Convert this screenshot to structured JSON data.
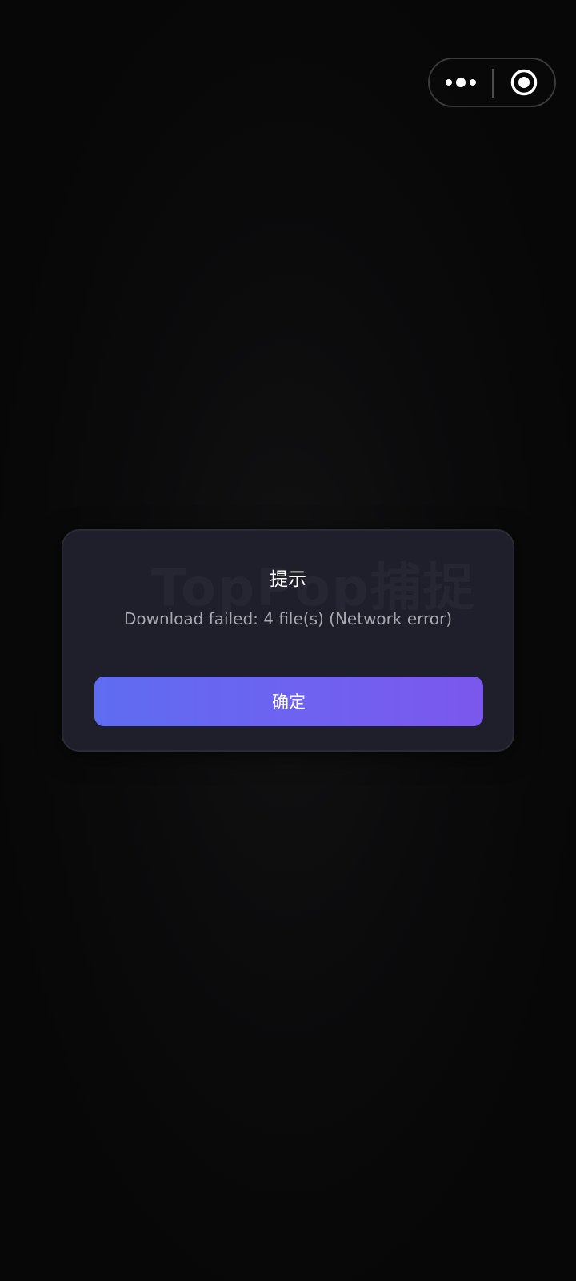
{
  "capsule": {
    "more_icon": "more-dots-icon",
    "close_icon": "close-target-icon"
  },
  "dialog": {
    "watermark": "TopPop捕捉",
    "title": "提示",
    "message": "Download failed: 4 file(s) (Network error)",
    "confirm_label": "确定"
  },
  "colors": {
    "background": "#070707",
    "dialog_bg": "#1f1e2b",
    "button_gradient_start": "#5f6cf2",
    "button_gradient_end": "#7b57ee",
    "title_text": "#ffffff",
    "message_text": "#a7a7ae"
  }
}
